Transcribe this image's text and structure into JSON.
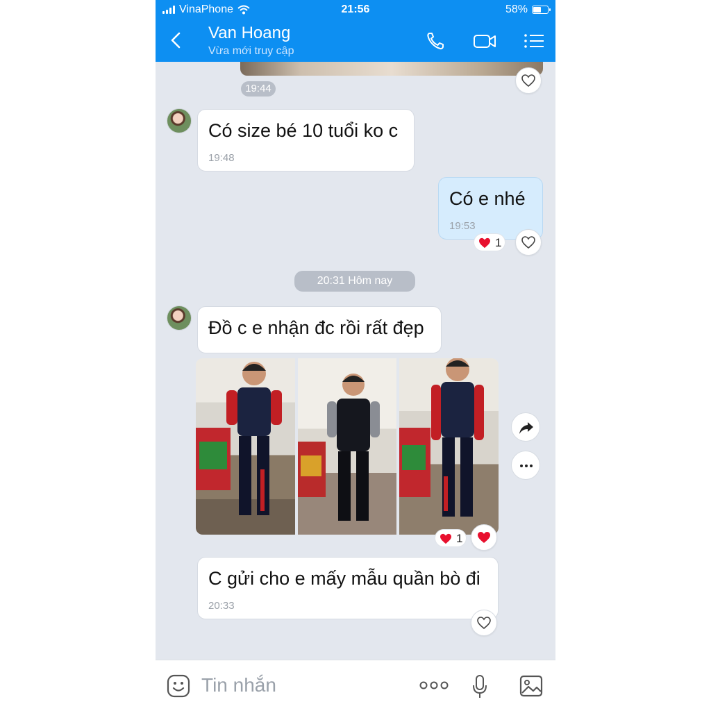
{
  "status_bar": {
    "carrier": "VinaPhone",
    "time": "21:56",
    "battery": "58%",
    "battery_level": 0.58
  },
  "header": {
    "name": "Van Hoang",
    "subtitle": "Vừa mới truy cập",
    "icons": [
      "back-icon",
      "phone-icon",
      "video-call-icon",
      "menu-list-icon"
    ]
  },
  "messages": [
    {
      "id": "m0",
      "sender": "them",
      "type": "image",
      "time": "19:44"
    },
    {
      "id": "m1",
      "sender": "them",
      "text": "Có size bé 10 tuổi ko c",
      "time": "19:48"
    },
    {
      "id": "m2",
      "sender": "me",
      "text": "Có e nhé",
      "time": "19:53",
      "reaction": {
        "emoji": "heart",
        "count": "1"
      }
    },
    {
      "id": "m3",
      "sender": "them",
      "text": "Đồ c e nhận đc rồi rất đẹp"
    },
    {
      "id": "m4",
      "sender": "them",
      "type": "photo-grid",
      "photo_count": 3,
      "reaction": {
        "emoji": "heart",
        "count": "1"
      }
    },
    {
      "id": "m5",
      "sender": "them",
      "text": "C gửi cho e mấy mẫu quần bò đi",
      "time": "20:33"
    }
  ],
  "date_separator": "20:31 Hôm nay",
  "input": {
    "placeholder": "Tin nhắn",
    "icons": [
      "emoji-icon",
      "more-dots-icon",
      "microphone-icon",
      "gallery-icon"
    ]
  },
  "colors": {
    "header_bg": "#0d8ff2",
    "chat_bg": "#e3e7ee",
    "my_bubble": "#d6ecfd",
    "heart": "#e8102e"
  }
}
